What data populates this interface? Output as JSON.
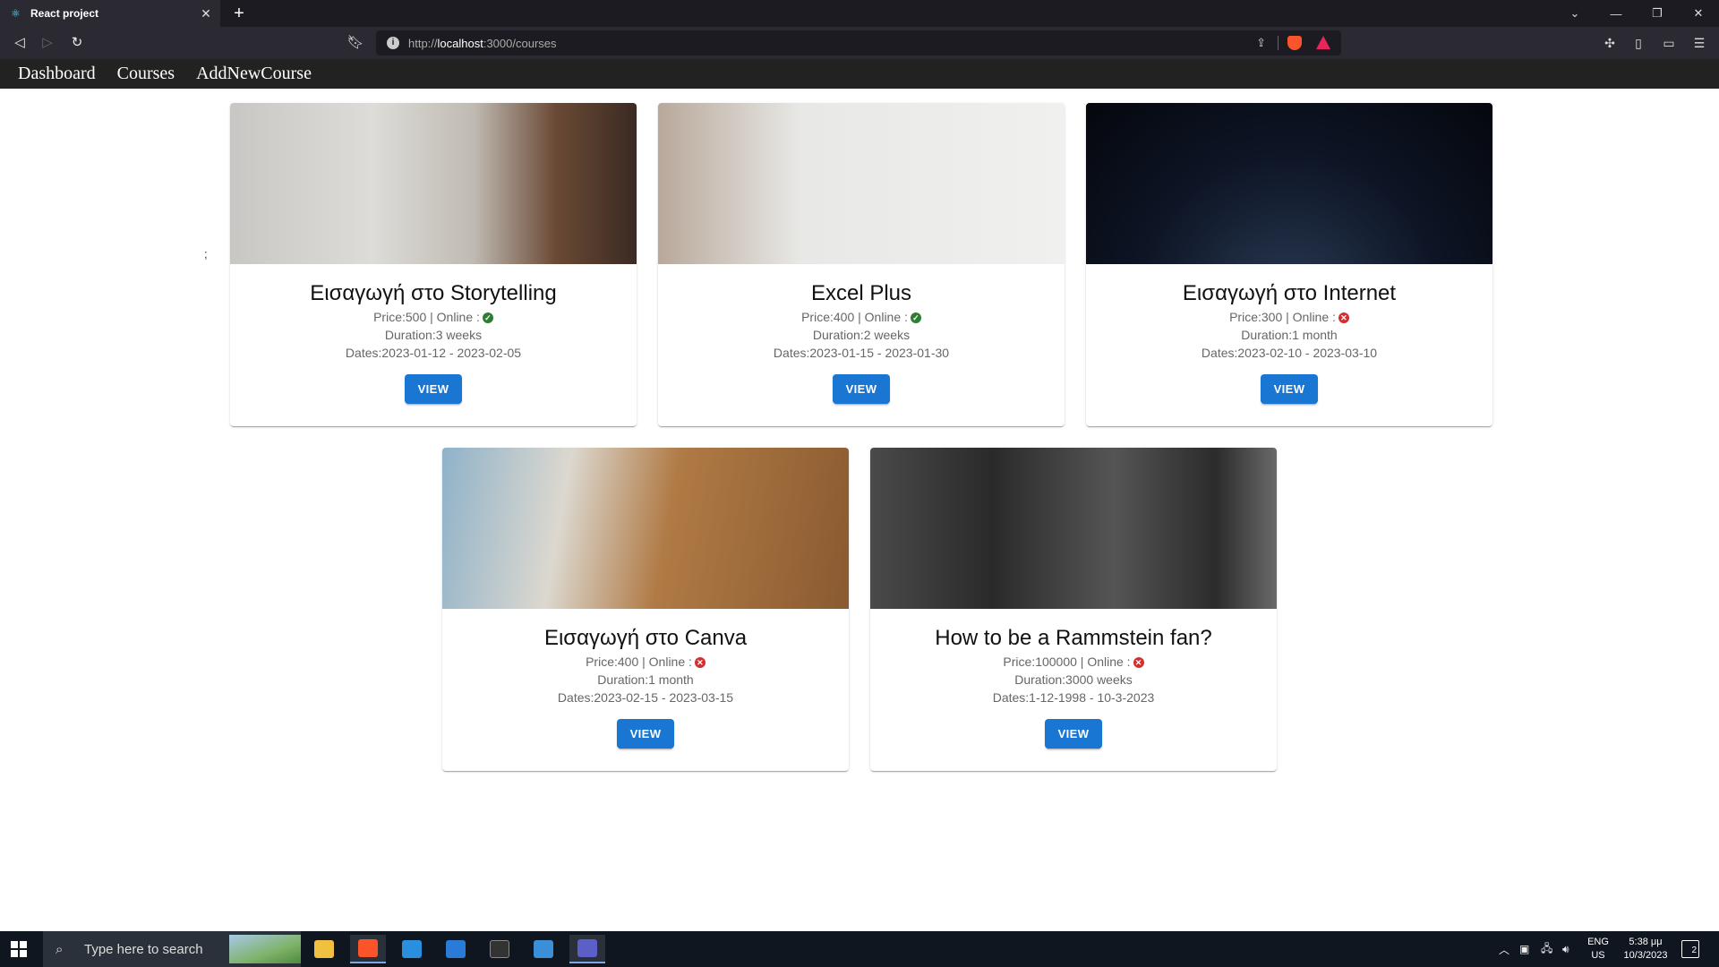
{
  "browser": {
    "tab_title": "React project",
    "new_tab": "+",
    "url_scheme": "http://",
    "url_host": "localhost",
    "url_path": ":3000/courses"
  },
  "nav": {
    "items": [
      "Dashboard",
      "Courses",
      "AddNewCourse"
    ]
  },
  "stray_text": ";",
  "courses": [
    {
      "title": "Εισαγωγή στο Storytelling",
      "price_line": "Price:500 | Online :",
      "online": true,
      "duration": "Duration:3 weeks",
      "dates": "Dates:2023-01-12 - 2023-02-05",
      "button": "VIEW"
    },
    {
      "title": "Excel Plus",
      "price_line": "Price:400 | Online :",
      "online": true,
      "duration": "Duration:2 weeks",
      "dates": "Dates:2023-01-15 - 2023-01-30",
      "button": "VIEW"
    },
    {
      "title": "Εισαγωγή στο Internet",
      "price_line": "Price:300 | Online :",
      "online": false,
      "duration": "Duration:1 month",
      "dates": "Dates:2023-02-10 - 2023-03-10",
      "button": "VIEW"
    },
    {
      "title": "Εισαγωγή στο Canva",
      "price_line": "Price:400 | Online :",
      "online": false,
      "duration": "Duration:1 month",
      "dates": "Dates:2023-02-15 - 2023-03-15",
      "button": "VIEW"
    },
    {
      "title": "How to be a Rammstein fan?",
      "price_line": "Price:100000 | Online :",
      "online": false,
      "duration": "Duration:3000 weeks",
      "dates": "Dates:1-12-1998 - 10-3-2023",
      "button": "VIEW"
    }
  ],
  "status_colors": {
    "online": "#2e7d32",
    "offline": "#d32f2f"
  },
  "accent_color": "#1976d2",
  "taskbar": {
    "search_placeholder": "Type here to search",
    "lang_1": "ENG",
    "lang_2": "US",
    "time": "5:38 μμ",
    "date": "10/3/2023",
    "notifications": "2"
  }
}
